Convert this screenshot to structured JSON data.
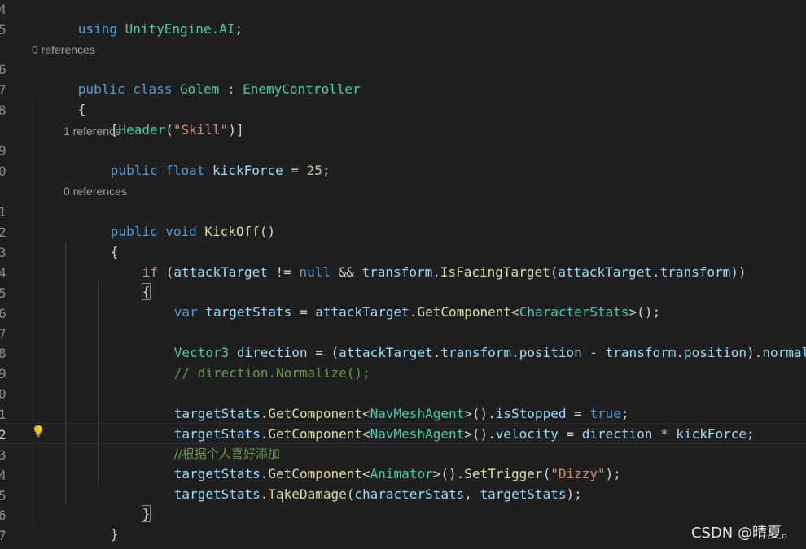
{
  "gutter": {
    "line_numbers": [
      "4",
      "5",
      "6",
      "7",
      "8",
      "9",
      "0",
      "1",
      "2",
      "3",
      "4",
      "5",
      "6",
      "7",
      "8",
      "9",
      "0",
      "1",
      "2",
      "3",
      "4",
      "5",
      "6",
      "7"
    ],
    "active_line": "2"
  },
  "codelens": {
    "golem_refs": "0 references",
    "kickforce_refs": "1 reference",
    "kickoff_refs": "0 references"
  },
  "code": {
    "l_using_kw": "using",
    "l_using_ns": "UnityEngine.AI",
    "l_using_end": ";",
    "l_class_kw1": "public",
    "l_class_kw2": "class",
    "l_class_name": "Golem",
    "l_class_colon": " : ",
    "l_class_base": "EnemyController",
    "l_open1": "{",
    "l_attr_open": "[",
    "l_attr_name": "Header",
    "l_attr_paren": "(",
    "l_attr_str": "\"Skill\"",
    "l_attr_close": ")]",
    "l_field_kw1": "public",
    "l_field_kw2": "float",
    "l_field_name": "kickForce",
    "l_field_eq": " = ",
    "l_field_val": "25",
    "l_field_end": ";",
    "l_method_kw1": "public",
    "l_method_kw2": "void",
    "l_method_name": "KickOff",
    "l_method_parens": "()",
    "l_open2": "{",
    "l_if_kw": "if",
    "l_if_p1": " (",
    "l_if_target": "attackTarget",
    "l_if_ne": " != ",
    "l_if_null": "null",
    "l_if_and": " && ",
    "l_if_transform": "transform",
    "l_if_dot": ".",
    "l_if_fn": "IsFacingTarget",
    "l_if_p2": "(",
    "l_if_arg1": "attackTarget",
    "l_if_dot2": ".",
    "l_if_arg2": "transform",
    "l_if_p3": "))",
    "l_open3": "{",
    "l_var_kw": "var",
    "l_var_name": "targetStats",
    "l_var_eq": " = ",
    "l_var_obj": "attackTarget",
    "l_var_dot": ".",
    "l_var_fn": "GetComponent",
    "l_var_lt": "<",
    "l_var_type": "CharacterStats",
    "l_var_end": ">();",
    "l_vec_type": "Vector3",
    "l_vec_name": "direction",
    "l_vec_eq": " = (",
    "l_vec_a": "attackTarget",
    "l_vec_d1": ".",
    "l_vec_b": "transform",
    "l_vec_d2": ".",
    "l_vec_c": "position",
    "l_vec_minus": " - ",
    "l_vec_e": "transform",
    "l_vec_d3": ".",
    "l_vec_f": "position",
    "l_vec_close": ").",
    "l_vec_g": "normalized;",
    "l_comment1": "// direction.Normalize();",
    "l_s1_obj": "targetStats",
    "l_s1_dot": ".",
    "l_s1_fn": "GetComponent",
    "l_s1_lt": "<",
    "l_s1_type": "NavMeshAgent",
    "l_s1_gt": ">().",
    "l_s1_prop": "isStopped",
    "l_s1_eq": " = ",
    "l_s1_val": "true",
    "l_s1_end": ";",
    "l_s2_obj": "targetStats",
    "l_s2_dot": ".",
    "l_s2_fn": "GetComponent",
    "l_s2_lt": "<",
    "l_s2_type": "NavMeshAgent",
    "l_s2_gt": ">().",
    "l_s2_prop": "velocity",
    "l_s2_eq": " = ",
    "l_s2_a": "direction",
    "l_s2_mul": " * ",
    "l_s2_b": "kickForce",
    "l_s2_end": ";",
    "l_comment2": "//根据个人喜好添加",
    "l_s3_obj": "targetStats",
    "l_s3_dot": ".",
    "l_s3_fn": "GetComponent",
    "l_s3_lt": "<",
    "l_s3_type": "Animator",
    "l_s3_gt": ">().",
    "l_s3_fn2": "SetTrigger",
    "l_s3_p": "(",
    "l_s3_str": "\"Dizzy\"",
    "l_s3_end": ");",
    "l_s4_obj": "targetStats",
    "l_s4_dot": ".",
    "l_s4_fn": "TakeDamage",
    "l_s4_p": "(",
    "l_s4_a": "characterStats",
    "l_s4_comma": ", ",
    "l_s4_b": "targetStats",
    "l_s4_end": ");",
    "l_close3": "}",
    "l_close2": "}",
    "l_close1": "}"
  },
  "overlay": {
    "ibeam": "I",
    "watermark": "CSDN @晴夏。"
  },
  "colors": {
    "background": "#1f1f1f",
    "keyword": "#569cd6",
    "control": "#c586c0",
    "type": "#4ec9b0",
    "function": "#dcdcaa",
    "variable": "#9cdcfe",
    "string": "#ce9178",
    "number": "#b5cea8",
    "comment": "#6a9955"
  },
  "icons": {
    "lightbulb": "lightbulb-icon"
  }
}
